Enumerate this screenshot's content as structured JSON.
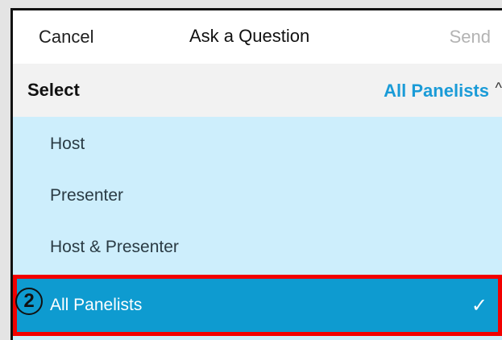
{
  "header": {
    "cancel_label": "Cancel",
    "title": "Ask a Question",
    "send_label": "Send"
  },
  "select": {
    "label": "Select",
    "value": "All Panelists",
    "chevron": "^"
  },
  "options": [
    {
      "label": "Host",
      "selected": false
    },
    {
      "label": "Presenter",
      "selected": false
    },
    {
      "label": "Host & Presenter",
      "selected": false
    },
    {
      "label": "All Panelists",
      "selected": true
    }
  ],
  "checkmark": "✓",
  "annotation": {
    "step_number": "2"
  },
  "colors": {
    "accent": "#1a9bd7",
    "selected_row": "#0e9bd0",
    "options_bg": "#cdeefc",
    "highlight_border": "#f20000"
  }
}
